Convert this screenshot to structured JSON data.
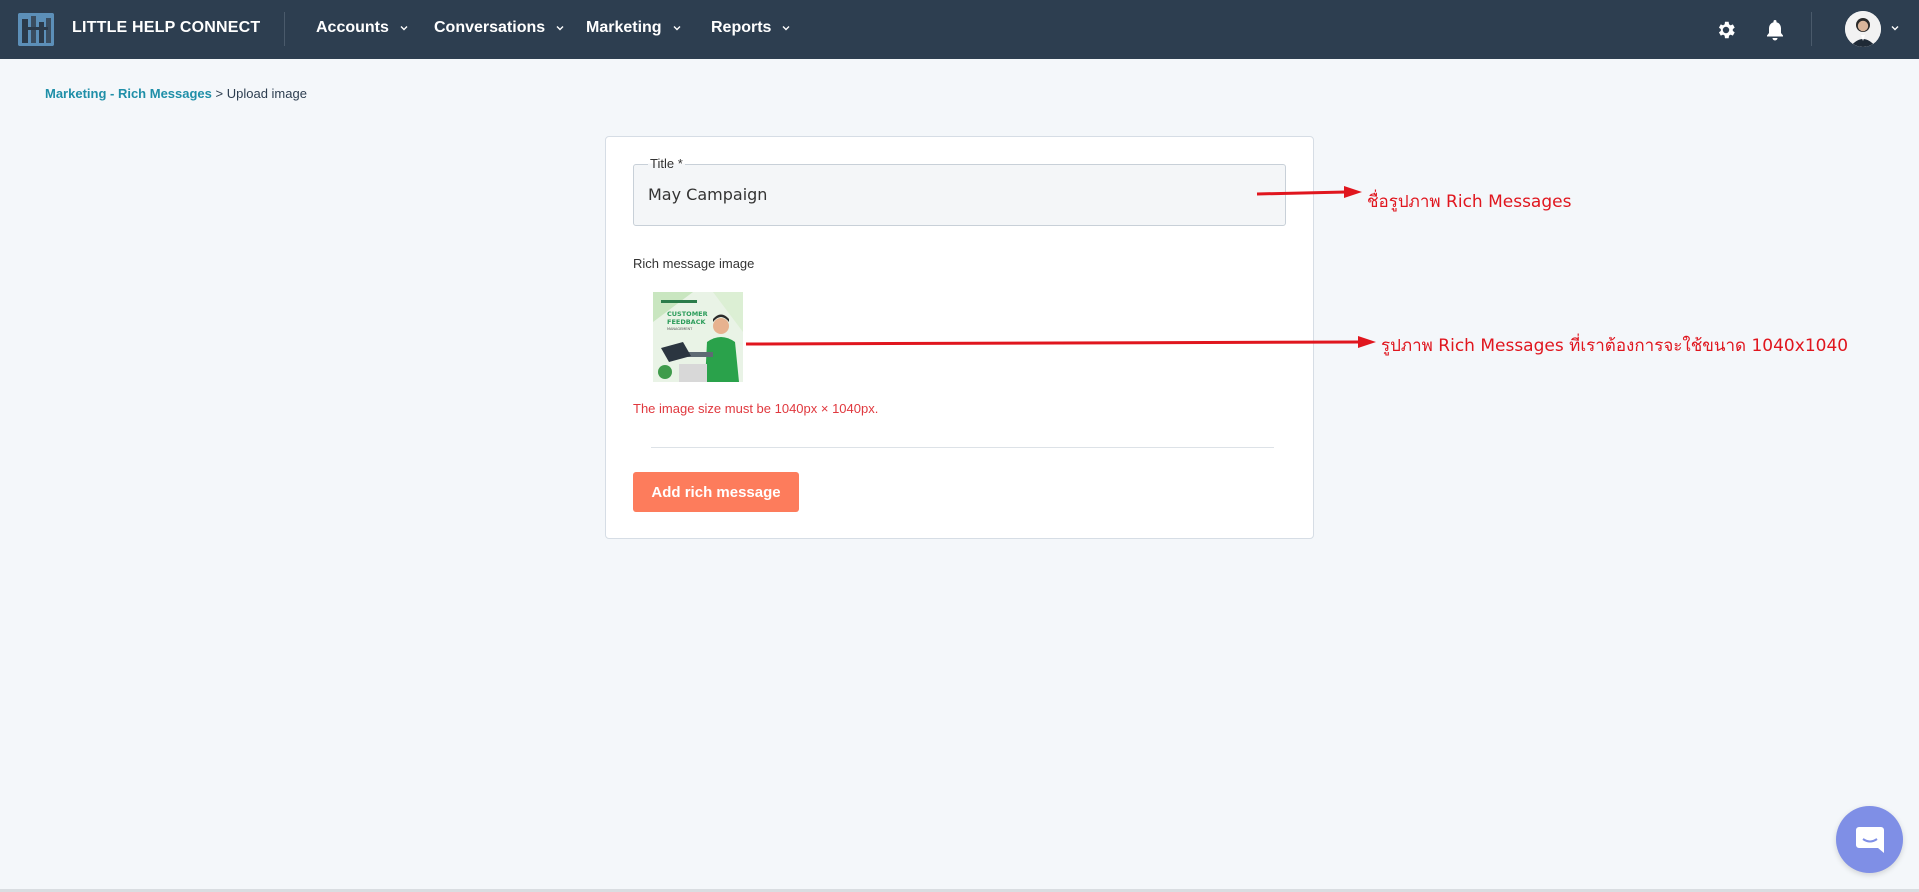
{
  "app": {
    "brand": "LITTLE HELP CONNECT"
  },
  "nav": {
    "items": [
      {
        "label": "Accounts",
        "icon": "chevron-down-icon"
      },
      {
        "label": "Conversations",
        "icon": "chevron-down-icon"
      },
      {
        "label": "Marketing",
        "icon": "chevron-down-icon"
      },
      {
        "label": "Reports",
        "icon": "chevron-down-icon"
      }
    ],
    "right_icons": [
      "gear-icon",
      "bell-icon",
      "avatar",
      "chevron-down-icon"
    ]
  },
  "breadcrumb": {
    "parent": "Marketing - Rich Messages",
    "separator": ">",
    "current": "Upload image"
  },
  "form": {
    "title_label": "Title *",
    "title_value": "May Campaign",
    "image_label": "Rich message image",
    "image_thumb_text": {
      "line1": "CUSTOMER",
      "line2": "FEEDBACK",
      "line3": "MANAGEMENT"
    },
    "image_error": "The image size must be 1040px × 1040px.",
    "submit_label": "Add rich message"
  },
  "annotations": {
    "title_note": "ชื่อรูปภาพ Rich Messages",
    "image_note": "รูปภาพ Rich Messages ที่เราต้องการจะใช้ขนาด 1040x1040",
    "color": "#e0161e"
  },
  "colors": {
    "navbar": "#2d3e50",
    "link": "#1f8fa8",
    "error": "#e0383e",
    "primary_button": "#fd7c5c",
    "chat_widget": "#7f8fe6"
  }
}
